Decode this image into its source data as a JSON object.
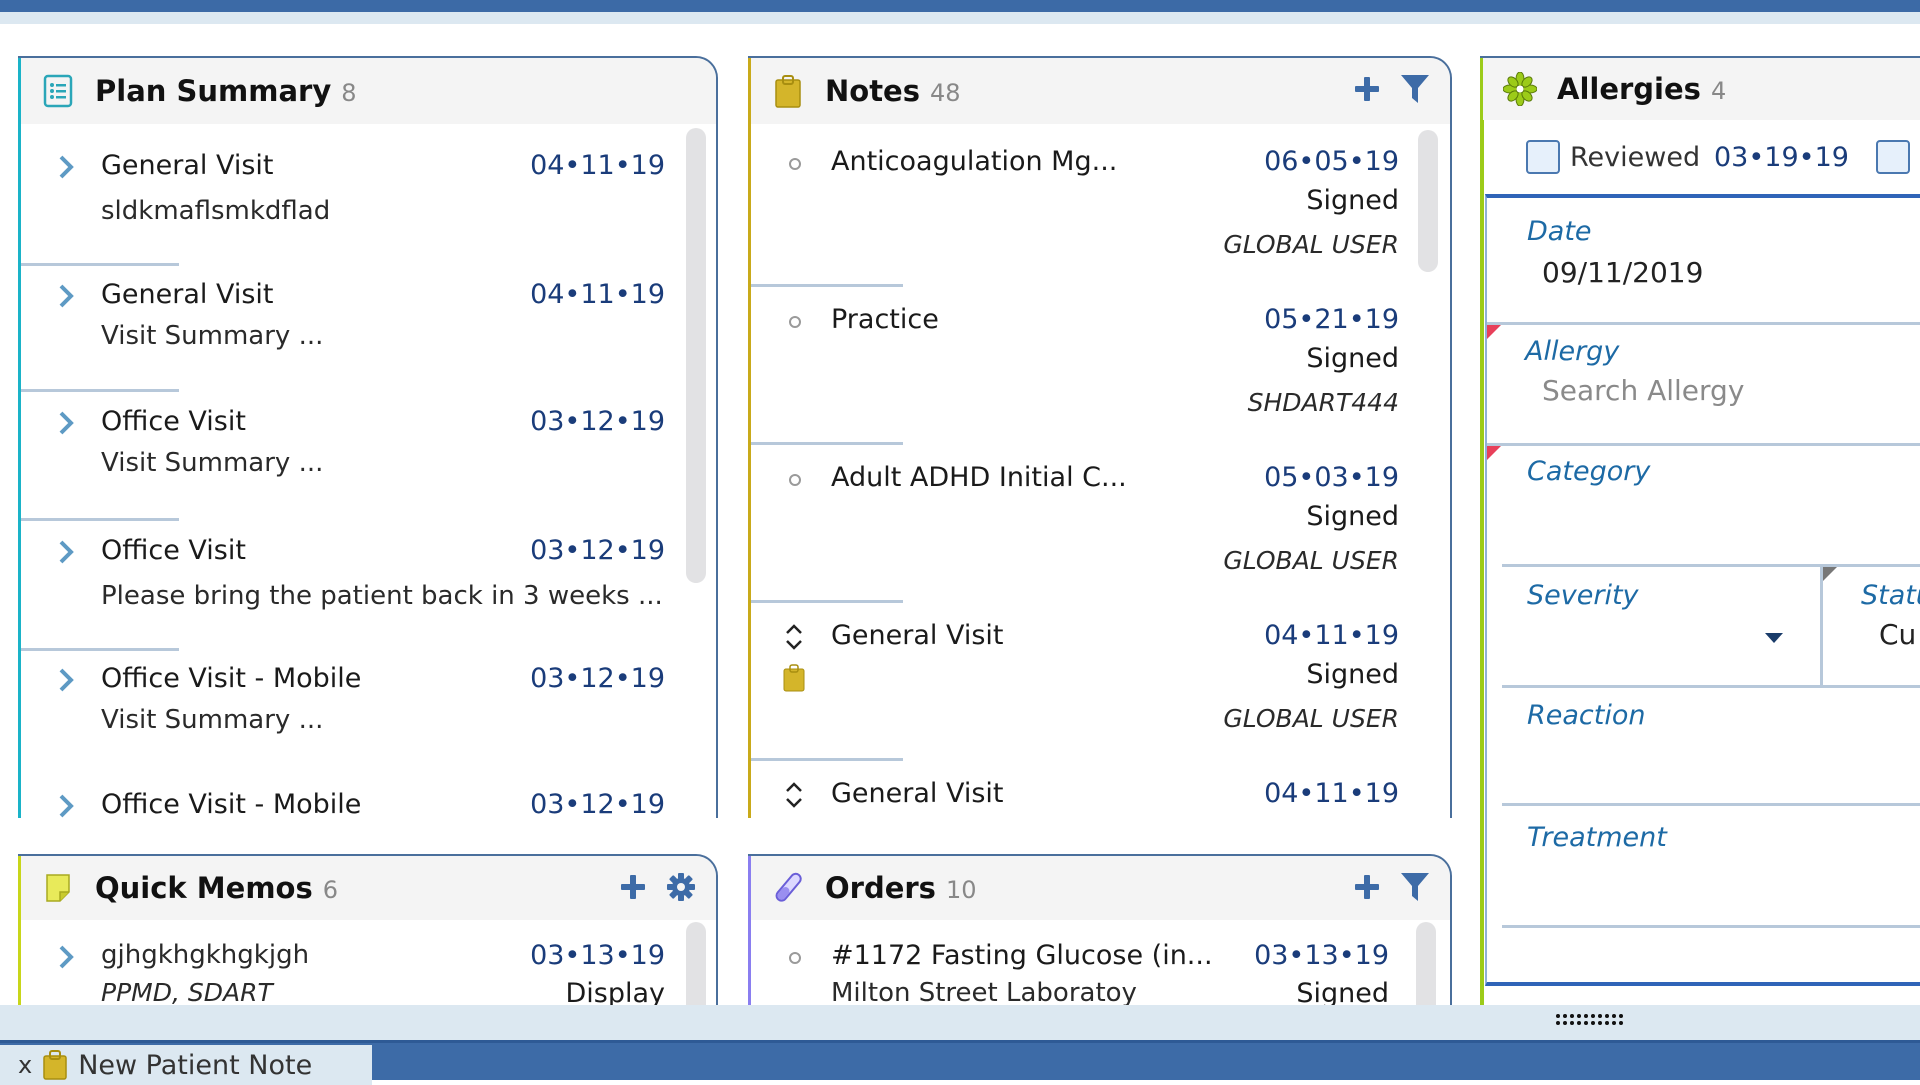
{
  "colors": {
    "plan_accent": "#1ab3c8",
    "notes_accent": "#c9aa1a",
    "memos_accent": "#c8d61a",
    "orders_accent": "#8a7ef0",
    "allergies_accent": "#9ccb19",
    "date_text": "#1a3c7a",
    "field_label": "#1d6aa5",
    "taskbar": "#3d6ba7"
  },
  "plan_summary": {
    "title": "Plan Summary",
    "count": "8",
    "icon": "list-icon",
    "items": [
      {
        "title": "General Visit",
        "subtitle": "sldkmaflsmkdflad",
        "date": "04•11•19"
      },
      {
        "title": "General Visit",
        "subtitle": "Visit Summary  ...",
        "date": "04•11•19"
      },
      {
        "title": "Office Visit",
        "subtitle": "Visit Summary  ...",
        "date": "03•12•19"
      },
      {
        "title": "Office Visit",
        "subtitle": "Please bring the patient back in 3 weeks ...",
        "date": "03•12•19"
      },
      {
        "title": "Office Visit - Mobile",
        "subtitle": "Visit Summary  ...",
        "date": "03•12•19"
      },
      {
        "title": "Office Visit - Mobile",
        "subtitle": "",
        "date": "03•12•19"
      }
    ]
  },
  "notes": {
    "title": "Notes",
    "count": "48",
    "icon": "clipboard-icon",
    "actions": [
      "add-icon",
      "filter-icon"
    ],
    "items": [
      {
        "icon": "bullet",
        "title": "Anticoagulation Mg...",
        "date": "06•05•19",
        "status": "Signed",
        "user": "GLOBAL USER"
      },
      {
        "icon": "bullet",
        "title": "Practice",
        "date": "05•21•19",
        "status": "Signed",
        "user": "SHDART444"
      },
      {
        "icon": "bullet",
        "title": "Adult ADHD Initial C...",
        "date": "05•03•19",
        "status": "Signed",
        "user": "GLOBAL USER"
      },
      {
        "icon": "expand",
        "title": "General Visit",
        "date": "04•11•19",
        "status": "Signed",
        "user": "GLOBAL USER",
        "has_clipboard": true
      },
      {
        "icon": "expand",
        "title": "General Visit",
        "date": "04•11•19",
        "status": "",
        "user": ""
      }
    ]
  },
  "allergies": {
    "title": "Allergies",
    "count": "4",
    "icon": "flower-icon",
    "reviewed_label": "Reviewed",
    "reviewed_date": "03•19•19",
    "reviewed_checked": false,
    "form": {
      "date_label": "Date",
      "date_value": "09/11/2019",
      "allergy_label": "Allergy",
      "allergy_placeholder": "Search Allergy",
      "category_label": "Category",
      "category_value": "",
      "severity_label": "Severity",
      "severity_value": "",
      "status_label": "Statu",
      "status_value": "Cu",
      "reaction_label": "Reaction",
      "reaction_value": "",
      "treatment_label": "Treatment",
      "treatment_value": ""
    }
  },
  "quick_memos": {
    "title": "Quick Memos",
    "count": "6",
    "icon": "sticky-note-icon",
    "actions": [
      "add-icon",
      "gear-icon"
    ],
    "items": [
      {
        "title": "gjhgkhgkhgkjgh",
        "date": "03•13•19",
        "user": "PPMD, SDART",
        "status": "Display"
      }
    ]
  },
  "orders": {
    "title": "Orders",
    "count": "10",
    "icon": "test-tube-icon",
    "actions": [
      "add-icon",
      "filter-icon"
    ],
    "items": [
      {
        "title": "#1172 Fasting Glucose (in...",
        "date": "03•13•19",
        "location": "Milton Street Laboratoy",
        "status": "Signed"
      }
    ]
  },
  "taskbar": {
    "tabs": [
      {
        "close": "x",
        "icon": "clipboard-icon",
        "label": "New Patient Note"
      }
    ]
  }
}
